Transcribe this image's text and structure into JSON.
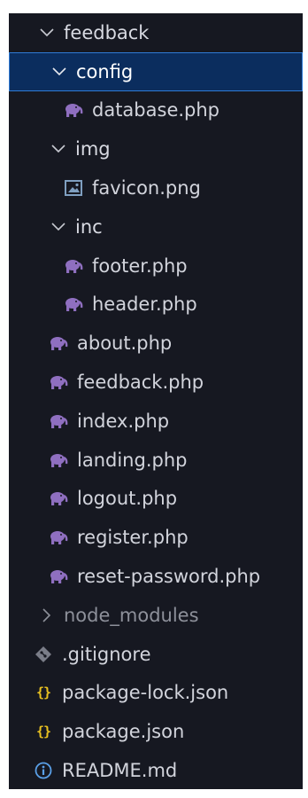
{
  "explorer": {
    "items": [
      {
        "label": "feedback",
        "kind": "folder",
        "expanded": true,
        "icon": "chevron-down-icon"
      },
      {
        "label": "config",
        "kind": "folder",
        "expanded": true,
        "icon": "chevron-down-icon",
        "selected": true
      },
      {
        "label": "database.php",
        "kind": "file",
        "icon": "php-elephant-icon"
      },
      {
        "label": "img",
        "kind": "folder",
        "expanded": true,
        "icon": "chevron-down-icon"
      },
      {
        "label": "favicon.png",
        "kind": "file",
        "icon": "image-icon"
      },
      {
        "label": "inc",
        "kind": "folder",
        "expanded": true,
        "icon": "chevron-down-icon"
      },
      {
        "label": "footer.php",
        "kind": "file",
        "icon": "php-elephant-icon"
      },
      {
        "label": "header.php",
        "kind": "file",
        "icon": "php-elephant-icon"
      },
      {
        "label": "about.php",
        "kind": "file",
        "icon": "php-elephant-icon"
      },
      {
        "label": "feedback.php",
        "kind": "file",
        "icon": "php-elephant-icon"
      },
      {
        "label": "index.php",
        "kind": "file",
        "icon": "php-elephant-icon"
      },
      {
        "label": "landing.php",
        "kind": "file",
        "icon": "php-elephant-icon"
      },
      {
        "label": "logout.php",
        "kind": "file",
        "icon": "php-elephant-icon"
      },
      {
        "label": "register.php",
        "kind": "file",
        "icon": "php-elephant-icon"
      },
      {
        "label": "reset-password.php",
        "kind": "file",
        "icon": "php-elephant-icon"
      },
      {
        "label": "node_modules",
        "kind": "folder",
        "expanded": false,
        "icon": "chevron-right-icon",
        "ignored": true
      },
      {
        "label": ".gitignore",
        "kind": "file",
        "icon": "git-diamond-icon"
      },
      {
        "label": "package-lock.json",
        "kind": "file",
        "icon": "json-braces-icon",
        "braces": "{}"
      },
      {
        "label": "package.json",
        "kind": "file",
        "icon": "json-braces-icon",
        "braces": "{}"
      },
      {
        "label": "README.md",
        "kind": "file",
        "icon": "info-icon"
      }
    ]
  },
  "colors": {
    "panel_bg": "#161821",
    "selected_bg": "#0b2d5e",
    "selected_border": "#2f7bd6",
    "text": "#d2d4dc",
    "muted_text": "#8d909a",
    "php_icon": "#8f6fc0",
    "json_icon": "#e8c020",
    "git_icon": "#7a7d88",
    "image_icon": "#7f9fc0",
    "info_icon": "#5aa0e8"
  }
}
